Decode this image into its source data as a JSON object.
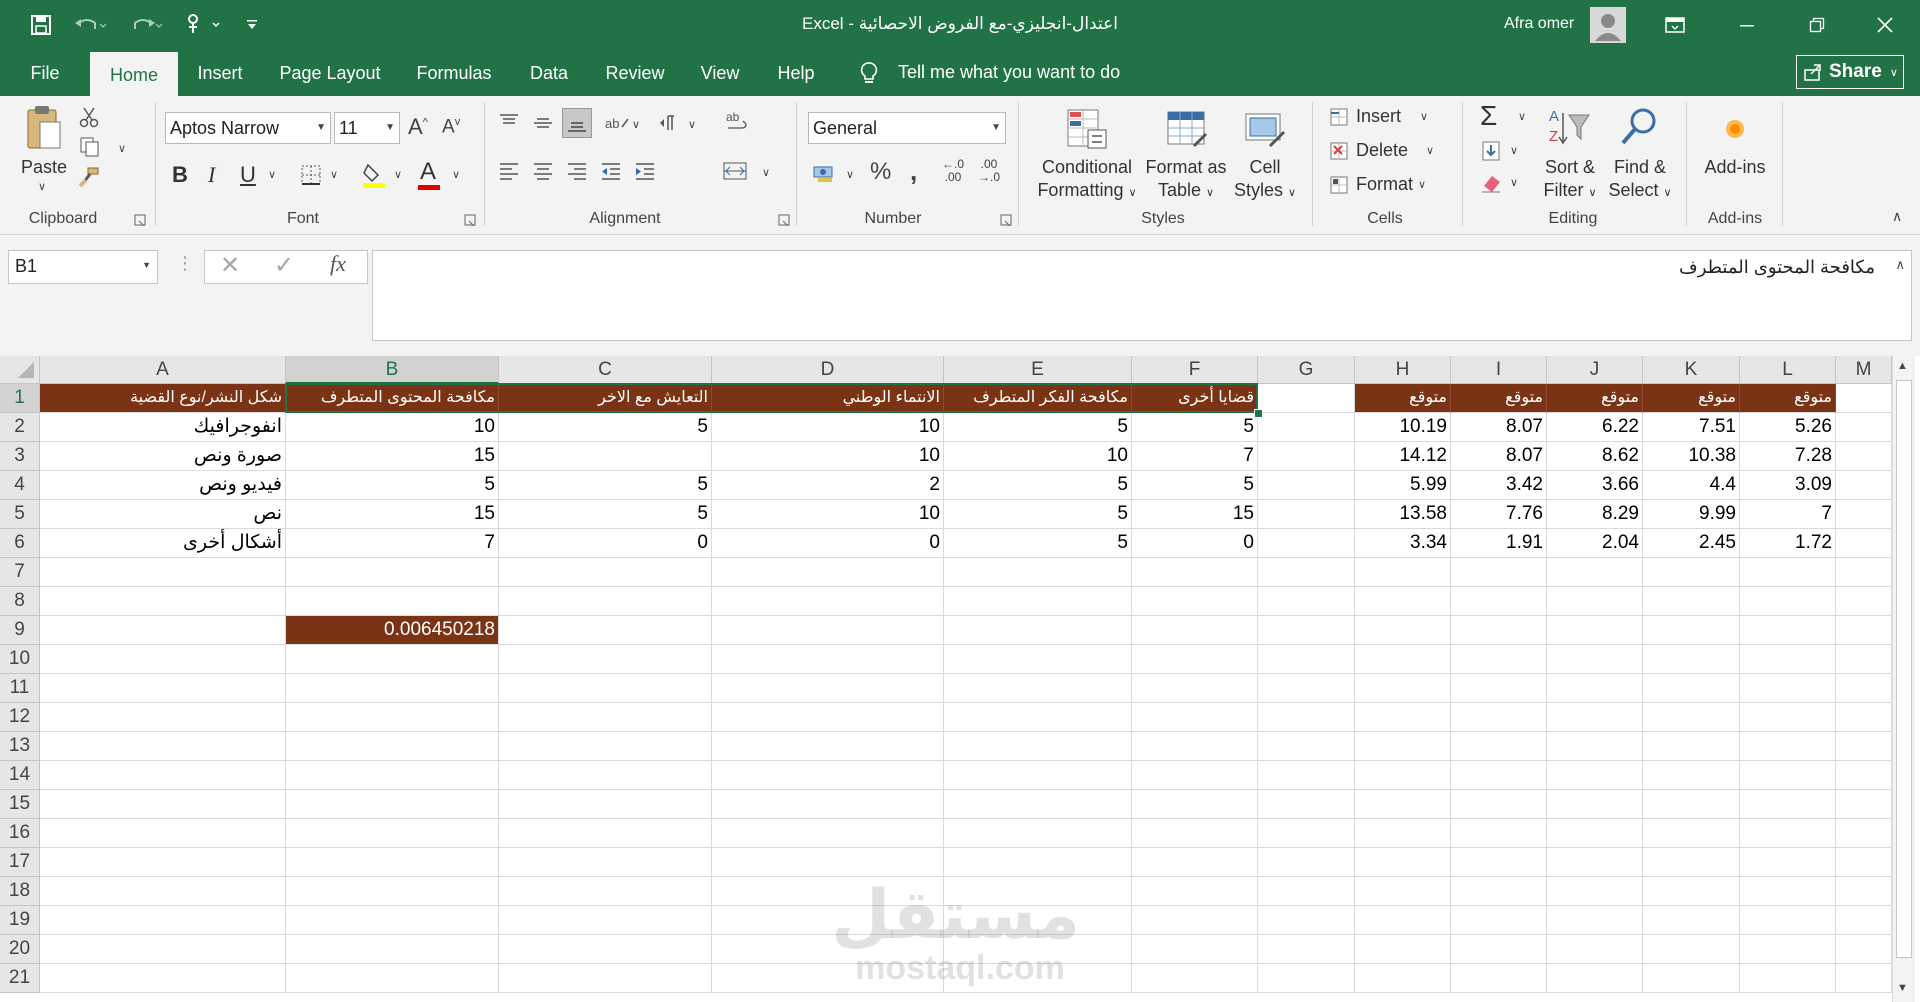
{
  "title_bar": {
    "doc_title": "اعتدال-انجليزي-مع الفروض الاحصائية  -  Excel",
    "user_name": "Afra omer"
  },
  "tabs": [
    "File",
    "Home",
    "Insert",
    "Page Layout",
    "Formulas",
    "Data",
    "Review",
    "View",
    "Help"
  ],
  "active_tab": "Home",
  "tell_me": "Tell me what you want to do",
  "share_label": "Share",
  "ribbon": {
    "clipboard": {
      "paste": "Paste",
      "group": "Clipboard"
    },
    "font": {
      "name": "Aptos Narrow",
      "size": "11",
      "bold": "B",
      "italic": "I",
      "underline": "U",
      "grow": "A",
      "shrink": "A",
      "font_color": "A",
      "group": "Font"
    },
    "alignment": {
      "group": "Alignment",
      "wrap_glyph": "ab"
    },
    "number": {
      "format": "General",
      "percent": "%",
      "comma": ",",
      "inc_dec": "←.0\n.00",
      "dec_dec": ".00\n→.0",
      "group": "Number"
    },
    "styles": {
      "conditional": [
        "Conditional",
        "Formatting"
      ],
      "format_table": [
        "Format as",
        "Table"
      ],
      "cell_styles": [
        "Cell",
        "Styles"
      ],
      "group": "Styles"
    },
    "cells": {
      "insert": "Insert",
      "delete": "Delete",
      "format": "Format",
      "group": "Cells"
    },
    "editing": {
      "sort": [
        "Sort &",
        "Filter"
      ],
      "find": [
        "Find &",
        "Select"
      ],
      "group": "Editing"
    },
    "addins": {
      "label": "Add-ins",
      "group": "Add-ins"
    }
  },
  "formula_bar": {
    "name_box": "B1",
    "fx": "fx",
    "content": "مكافحة المحتوى المتطرف"
  },
  "sheet": {
    "columns": [
      "A",
      "B",
      "C",
      "D",
      "E",
      "F",
      "G",
      "H",
      "I",
      "J",
      "K",
      "L",
      "M"
    ],
    "rows": [
      "1",
      "2",
      "3",
      "4",
      "5",
      "6",
      "7",
      "8",
      "9",
      "10",
      "11",
      "12",
      "13",
      "14",
      "15",
      "16",
      "17",
      "18",
      "19",
      "20",
      "21"
    ],
    "header_row": [
      "شكل النشر/نوع القضية",
      "مكافحة المحتوى المتطرف",
      "التعايش مع الاخر",
      "الانتماء الوطني",
      "مكافحة الفكر المتطرف",
      "قضايا أخرى"
    ],
    "expected_header": [
      "متوقع",
      "متوقع",
      "متوقع",
      "متوقع",
      "متوقع"
    ],
    "data_rows": [
      {
        "label": "انفوجرافيك",
        "values": [
          "10",
          "5",
          "10",
          "5",
          "5"
        ],
        "expected": [
          "10.19",
          "8.07",
          "6.22",
          "7.51",
          "5.26"
        ]
      },
      {
        "label": "صورة ونص",
        "values": [
          "15",
          "",
          "10",
          "10",
          "7"
        ],
        "expected": [
          "14.12",
          "8.07",
          "8.62",
          "10.38",
          "7.28"
        ]
      },
      {
        "label": "فيديو ونص",
        "values": [
          "5",
          "5",
          "2",
          "5",
          "5"
        ],
        "expected": [
          "5.99",
          "3.42",
          "3.66",
          "4.4",
          "3.09"
        ]
      },
      {
        "label": "نص",
        "values": [
          "15",
          "5",
          "10",
          "5",
          "15"
        ],
        "expected": [
          "13.58",
          "7.76",
          "8.29",
          "9.99",
          "7"
        ]
      },
      {
        "label": "أشكال أخرى",
        "values": [
          "7",
          "0",
          "0",
          "5",
          "0"
        ],
        "expected": [
          "3.34",
          "1.91",
          "2.04",
          "2.45",
          "1.72"
        ]
      }
    ],
    "b9_value": "0.006450218"
  },
  "watermark": {
    "arabic": "مستقل",
    "latin": "mostaql.com"
  },
  "colors": {
    "excel_green": "#217346",
    "header_brown": "#7a3314"
  }
}
